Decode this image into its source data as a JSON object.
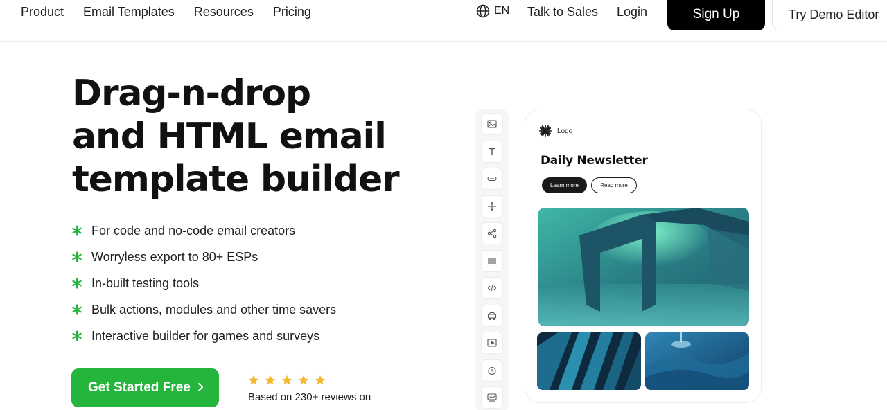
{
  "nav": {
    "links": [
      "Product",
      "Email Templates",
      "Resources",
      "Pricing"
    ],
    "language": "EN",
    "talk_to_sales": "Talk to Sales",
    "login": "Login",
    "sign_up": "Sign Up",
    "try_demo": "Try Demo Editor"
  },
  "hero": {
    "title_lines": [
      "Drag-n-drop",
      "and HTML email",
      "template builder"
    ],
    "features": [
      "For code and no-code email creators",
      "Worryless export to 80+ ESPs",
      "In-built testing tools",
      "Bulk actions, modules and other time savers",
      "Interactive builder for games and surveys"
    ],
    "cta_label": "Get Started Free",
    "rating_stars": 5,
    "reviews_text": "Based on 230+ reviews on"
  },
  "builder": {
    "tools": [
      "image-icon",
      "text-icon",
      "button-icon",
      "spacer-icon",
      "social-icon",
      "divider-icon",
      "html-icon",
      "menu-icon",
      "video-icon",
      "timer-icon",
      "banner-icon"
    ],
    "preview": {
      "logo_text": "Logo",
      "title": "Daily Newsletter",
      "learn_more": "Learn more",
      "read_more": "Read more"
    }
  },
  "colors": {
    "accent_green": "#25b53d",
    "star_yellow": "#f5b82e",
    "sign_up_bg": "#000000"
  }
}
